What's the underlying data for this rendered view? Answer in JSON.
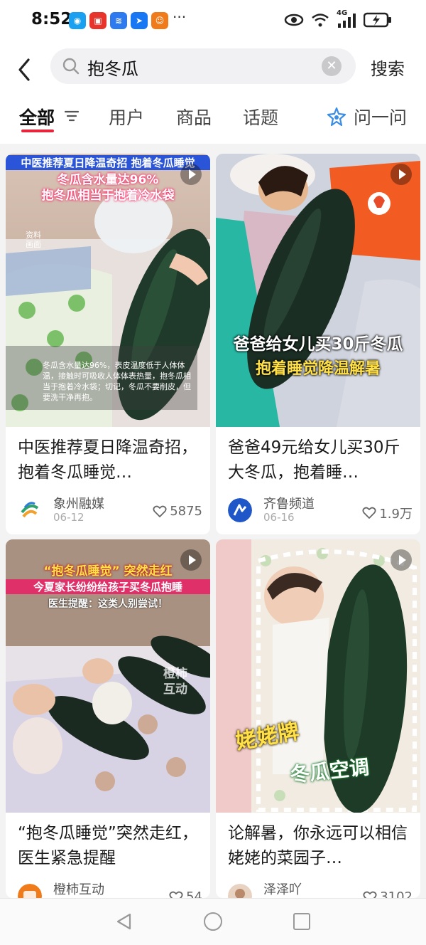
{
  "status_bar": {
    "time": "8:52",
    "more": "···",
    "network": "4G",
    "notif_apps": [
      "chat-app-icon",
      "red-app-icon",
      "voice-app-icon",
      "map-app-icon",
      "orange-app-icon"
    ]
  },
  "search": {
    "query": "抱冬瓜",
    "button_label": "搜索"
  },
  "tabs": [
    {
      "label": "全部",
      "active": true
    },
    {
      "label": "用户",
      "active": false
    },
    {
      "label": "商品",
      "active": false
    },
    {
      "label": "话题",
      "active": false
    },
    {
      "label": "问一问",
      "active": false
    }
  ],
  "cards": [
    {
      "title": "中医推荐夏日降温奇招，抱着冬瓜睡觉…",
      "overlay_lines": [
        "中医推荐夏日降温奇招 抱着冬瓜睡觉",
        "冬瓜含水量达96%",
        "抱冬瓜相当于抱着冷水袋"
      ],
      "side_label": "资料画面",
      "caption_text": "冬瓜含水量达96%，表皮温度低于人体体温，接触时可吸收人体体表热量，抱冬瓜相当于抱着冷水袋；切记，冬瓜不要削皮，但要洗干净再抱。",
      "author": "象州融媒",
      "date": "06-12",
      "likes": "5875"
    },
    {
      "title": "爸爸49元给女儿买30斤大冬瓜，抱着睡…",
      "overlay_lines": [
        "爸爸给女儿买30斤冬瓜",
        "抱着睡觉降温解暑"
      ],
      "author": "齐鲁频道",
      "date": "06-16",
      "likes": "1.9万"
    },
    {
      "title": "“抱冬瓜睡觉”突然走红，医生紧急提醒",
      "overlay_lines": [
        "“抱冬瓜睡觉” 突然走红",
        "今夏家长纷纷给孩子买冬瓜抱睡",
        "医生提醒：这类人别尝试！"
      ],
      "watermark": "橙柿互动",
      "author": "橙柿互动",
      "date": "",
      "likes": "54"
    },
    {
      "title": "论解暑，你永远可以相信姥姥的菜园子…",
      "overlay_lines": [
        "姥姥牌",
        "冬瓜空调"
      ],
      "author": "泽泽吖",
      "date": "",
      "likes": "3102"
    }
  ],
  "colors": {
    "accent": "#e6263a",
    "melon": "#1f3a2a",
    "overlay_yellow": "#ffe046",
    "overlay_pink": "#ff3b6a"
  }
}
